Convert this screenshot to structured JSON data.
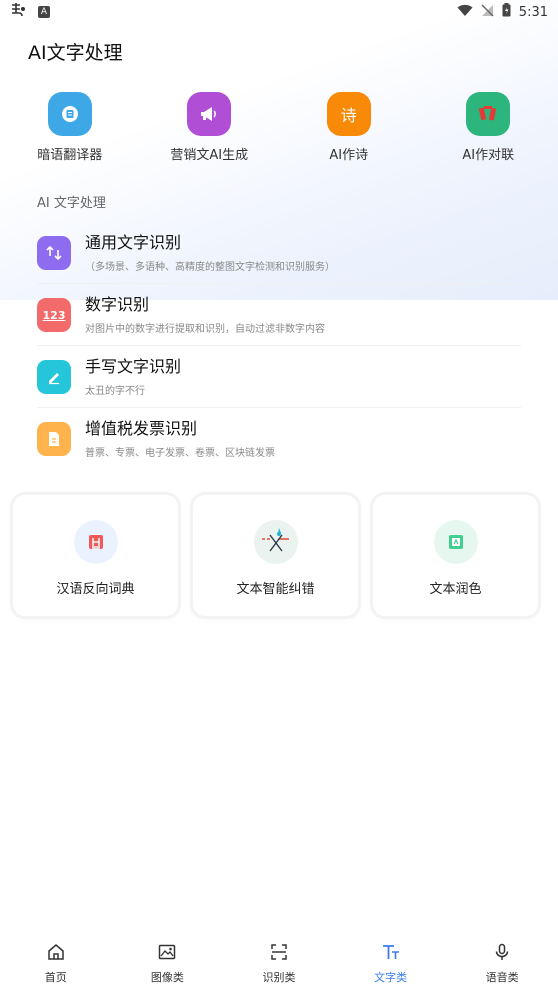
{
  "status_bar": {
    "time": "5:31",
    "left_icon_a": "A"
  },
  "page_title": "AI文字处理",
  "top_tools": [
    {
      "label": "暗语翻译器",
      "icon": "translate-icon",
      "color": "#3ea7e6"
    },
    {
      "label": "营销文AI生成",
      "icon": "megaphone-icon",
      "color": "#b04fd6"
    },
    {
      "label": "AI作诗",
      "icon": "poem-icon",
      "color": "#f98a07",
      "glyph": "诗"
    },
    {
      "label": "AI作对联",
      "icon": "couplet-icon",
      "color": "#2cb57c"
    }
  ],
  "section_title": "AI 文字处理",
  "list": [
    {
      "title": "通用文字识别",
      "subtitle": "（多场景、多语种、高精度的整图文字检测和识别服务）",
      "icon": "general-ocr-icon",
      "color": "#8e6cf0"
    },
    {
      "title": "数字识别",
      "subtitle": "对图片中的数字进行提取和识别，自动过滤非数字内容",
      "icon": "number-ocr-icon",
      "color": "#f26a6a",
      "glyph": "123"
    },
    {
      "title": "手写文字识别",
      "subtitle": "太丑的字不行",
      "icon": "handwriting-icon",
      "color": "#26c6da"
    },
    {
      "title": "增值税发票识别",
      "subtitle": "普票、专票、电子发票、卷票、区块链发票",
      "icon": "invoice-icon",
      "color": "#ffb34d"
    }
  ],
  "cards": [
    {
      "label": "汉语反向词典",
      "icon": "dictionary-icon",
      "bg": "#eaf2ff"
    },
    {
      "label": "文本智能纠错",
      "icon": "correction-icon",
      "bg": "#eaf3ef"
    },
    {
      "label": "文本润色",
      "icon": "polish-icon",
      "bg": "#e5f7ef"
    }
  ],
  "bottom_nav": [
    {
      "label": "首页",
      "icon": "home-icon"
    },
    {
      "label": "图像类",
      "icon": "image-icon"
    },
    {
      "label": "识别类",
      "icon": "scan-icon"
    },
    {
      "label": "文字类",
      "icon": "text-icon",
      "active": true
    },
    {
      "label": "语音类",
      "icon": "mic-icon"
    }
  ],
  "colors": {
    "accent": "#3a7bf0"
  }
}
